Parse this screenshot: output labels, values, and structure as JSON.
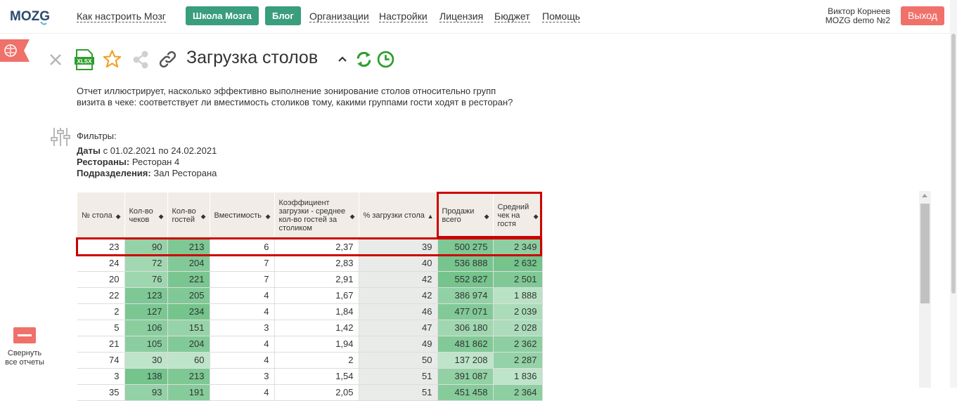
{
  "logo_text": "MOZG",
  "nav": {
    "links": [
      "Как настроить Мозг",
      "Организации",
      "Настройки",
      "Лицензия",
      "Бюджет",
      "Помощь"
    ],
    "buttons": [
      "Школа Мозга",
      "Блог"
    ]
  },
  "user": {
    "name": "Виктор Корнеев",
    "org": "MOZG demo №2"
  },
  "logout_label": "Выход",
  "collapse_label": "Свернуть все отчеты",
  "report": {
    "title": "Загрузка столов",
    "description": "Отчет иллюстрирует, насколько эффективно выполнение зонирование столов относительно групп визита в чеке: соответствует ли вместимость столиков тому, какими группами гости ходят в ресторан?",
    "filters_label": "Фильтры:",
    "filters": {
      "dates_label": "Даты",
      "dates_value": "с 01.02.2021 по 24.02.2021",
      "restaurants_label": "Рестораны:",
      "restaurants_value": "Ресторан 4",
      "divisions_label": "Подразделения:",
      "divisions_value": "Зал Ресторана"
    }
  },
  "icons": [
    "close-icon",
    "xlsx-icon",
    "star-icon",
    "share-icon",
    "link-icon",
    "chevron-up-icon",
    "refresh-icon",
    "clock-icon",
    "filter-sliders-icon",
    "brain-icon"
  ],
  "colors": {
    "brand_green": "#3a9d7d",
    "logout_red": "#f0706a",
    "highlight_red": "#cc0000",
    "icon_green": "#2e9e2e",
    "star_orange": "#f0a020"
  },
  "table": {
    "columns": [
      "№ стола",
      "Кол-во чеков",
      "Кол-во гостей",
      "Вместимость",
      "Коэффициент загрузки - среднее кол-во гостей за столиком",
      "% загрузки стола",
      "Продажи всего",
      "Средний чек на гостя"
    ],
    "sorted_column": "% загрузки стола",
    "rows": [
      [
        "23",
        "90",
        "213",
        "6",
        "2,37",
        "39",
        "500 275",
        "2 349"
      ],
      [
        "24",
        "72",
        "204",
        "7",
        "2,83",
        "40",
        "536 888",
        "2 632"
      ],
      [
        "20",
        "76",
        "221",
        "7",
        "2,91",
        "42",
        "552 827",
        "2 501"
      ],
      [
        "22",
        "123",
        "205",
        "4",
        "1,67",
        "42",
        "386 974",
        "1 888"
      ],
      [
        "2",
        "127",
        "234",
        "4",
        "1,84",
        "46",
        "477 071",
        "2 039"
      ],
      [
        "5",
        "106",
        "151",
        "3",
        "1,42",
        "47",
        "306 180",
        "2 028"
      ],
      [
        "21",
        "105",
        "204",
        "4",
        "1,94",
        "49",
        "481 862",
        "2 362"
      ],
      [
        "74",
        "30",
        "60",
        "4",
        "2",
        "50",
        "137 208",
        "2 287"
      ],
      [
        "3",
        "138",
        "213",
        "3",
        "1,54",
        "51",
        "391 087",
        "1 836"
      ],
      [
        "35",
        "93",
        "191",
        "4",
        "2,05",
        "51",
        "451 458",
        "2 364"
      ]
    ]
  }
}
